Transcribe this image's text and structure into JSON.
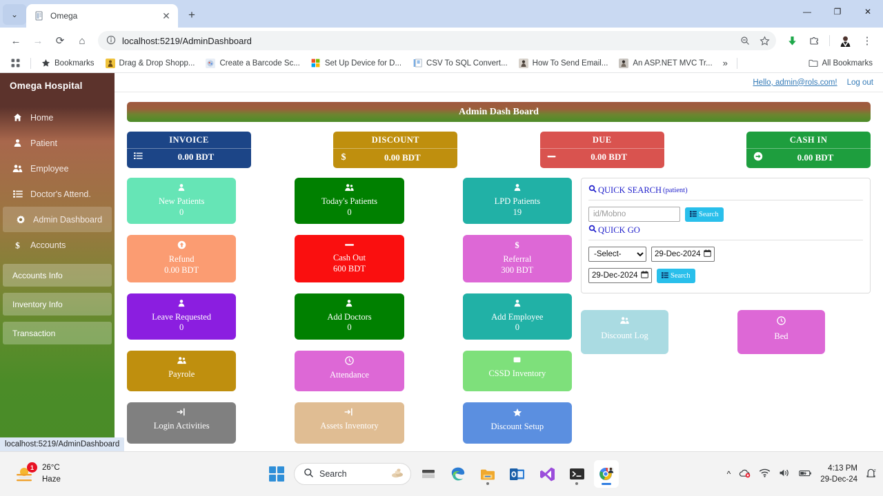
{
  "browser": {
    "tab": {
      "title": "Omega",
      "favicon": "document-icon",
      "close_label": "✕"
    },
    "newtab_label": "+",
    "tab_list_label": "⌄",
    "window_controls": {
      "minimize": "—",
      "restore": "❐",
      "close": "✕"
    },
    "nav": {
      "back": "←",
      "forward": "→",
      "reload": "⟳",
      "home": "⌂"
    },
    "omnibox": {
      "info_icon": "info-icon",
      "url": "localhost:5219/AdminDashboard",
      "zoom_icon": "zoom-out-icon",
      "bookmark_icon": "star-icon"
    },
    "toolbar_right": {
      "downloads": "download-icon",
      "extensions": "extensions-icon",
      "profile": "profile-avatar",
      "menu": "⋮"
    },
    "bookmarks": {
      "apps_icon": "apps-grid-icon",
      "items": [
        {
          "label": "Bookmarks",
          "icon": "star-icon"
        },
        {
          "label": "Drag & Drop Shopp...",
          "icon": "site-favicon"
        },
        {
          "label": "Create a Barcode Sc...",
          "icon": "site-favicon"
        },
        {
          "label": "Set Up Device for D...",
          "icon": "microsoft-icon"
        },
        {
          "label": "CSV To SQL Convert...",
          "icon": "site-favicon"
        },
        {
          "label": "How To Send Email...",
          "icon": "site-favicon"
        },
        {
          "label": "An ASP.NET MVC Tr...",
          "icon": "site-favicon"
        }
      ],
      "overflow": "»",
      "all_bookmarks": "All Bookmarks"
    },
    "status_bubble": "localhost:5219/AdminDashboard"
  },
  "sidebar": {
    "brand": "Omega Hospital",
    "items": [
      {
        "label": "Home",
        "icon": "home-icon"
      },
      {
        "label": "Patient",
        "icon": "user-icon"
      },
      {
        "label": "Employee",
        "icon": "users-icon"
      },
      {
        "label": "Doctor's Attend.",
        "icon": "list-icon"
      },
      {
        "label": "Admin Dashboard",
        "icon": "gear-icon",
        "active": true
      },
      {
        "label": "Accounts",
        "icon": "dollar-icon"
      }
    ],
    "groups": [
      {
        "label": "Accounts Info"
      },
      {
        "label": "Inventory Info"
      },
      {
        "label": "Transaction"
      }
    ]
  },
  "userbar": {
    "hello": "Hello, admin@rols.com!",
    "logout": "Log out"
  },
  "page": {
    "banner_title": "Admin Dash Board",
    "stats": [
      {
        "title": "INVOICE",
        "value": "0.00 BDT",
        "icon": "list-icon",
        "color": "#1c4587"
      },
      {
        "title": "DISCOUNT",
        "value": "0.00 BDT",
        "icon": "dollar-icon",
        "color": "#bf8f0e"
      },
      {
        "title": "DUE",
        "value": "0.00 BDT",
        "icon": "minus-icon",
        "color": "#d9534f"
      },
      {
        "title": "CASH IN",
        "value": "0.00 BDT",
        "icon": "arrow-right-circle-icon",
        "color": "#1e9e3e"
      }
    ],
    "tiles": [
      {
        "label": "New Patients",
        "value": "0",
        "icon": "user-icon",
        "color": "#66e5b6",
        "height": "tall"
      },
      {
        "label": "Today's Patients",
        "value": "0",
        "icon": "users-icon",
        "color": "#008000",
        "height": "tall"
      },
      {
        "label": "LPD Patients",
        "value": "19",
        "icon": "user-icon",
        "color": "#21b1a6",
        "height": "tall"
      },
      {
        "label": "Refund",
        "value": "0.00 BDT",
        "icon": "arrow-up-circle-icon",
        "color": "#fb9c72",
        "height": "tall"
      },
      {
        "label": "Cash Out",
        "value": "600 BDT",
        "icon": "minus-icon",
        "color": "#fa0f0f",
        "height": "tall"
      },
      {
        "label": "Referral",
        "value": "300 BDT",
        "icon": "dollar-icon",
        "color": "#dd68d6",
        "height": "tall"
      },
      {
        "label": "Leave Requested",
        "value": "0",
        "icon": "user-icon",
        "color": "#8b1ee0",
        "height": "tall"
      },
      {
        "label": "Add Doctors",
        "value": "0",
        "icon": "user-icon",
        "color": "#008000",
        "height": "tall"
      },
      {
        "label": "Add Employee",
        "value": "0",
        "icon": "user-icon",
        "color": "#21b1a6",
        "height": "tall"
      },
      {
        "label": "Payrole",
        "value": "",
        "icon": "users-icon",
        "color": "#bf8f0e",
        "height": "short"
      },
      {
        "label": "Attendance",
        "value": "",
        "icon": "clock-icon",
        "color": "#dd68d6",
        "height": "short"
      },
      {
        "label": "CSSD Inventory",
        "value": "",
        "icon": "square-icon",
        "color": "#7ee07b",
        "height": "short"
      },
      {
        "label": "Login Activities",
        "value": "",
        "icon": "login-icon",
        "color": "#808080",
        "height": "short"
      },
      {
        "label": "Assets Inventory",
        "value": "",
        "icon": "login-icon",
        "color": "#e0bd93",
        "height": "short"
      },
      {
        "label": "Discount Setup",
        "value": "",
        "icon": "star-icon",
        "color": "#5b8fe0",
        "height": "short"
      }
    ],
    "search_panel": {
      "quick_search_title": "QUICK SEARCH",
      "quick_search_sub": "(patient)",
      "quick_search_icon": "search-icon",
      "id_placeholder": "id/Mobno",
      "id_value": "",
      "search_button": "Search",
      "search_button_icon": "list-icon",
      "quick_go_title": "QUICK GO",
      "quick_go_icon": "search-icon",
      "select_value": "-Select-",
      "select_options": [
        "-Select-"
      ],
      "date_from": "29-Dec-2024",
      "date_to": "29-Dec-2024",
      "calendar_icon": "calendar-icon",
      "search_button2": "Search",
      "search_button2_icon": "list-icon"
    },
    "bottom_tiles": [
      {
        "label": "Discount Log",
        "icon": "users-icon",
        "color": "#aadbe2"
      },
      {
        "label": "Bed",
        "icon": "clock-icon",
        "color": "#dd68d6"
      }
    ]
  },
  "taskbar": {
    "weather": {
      "temp": "26°C",
      "condition": "Haze",
      "badge": "1",
      "icon": "haze-icon"
    },
    "start_label": "windows-start-icon",
    "search_placeholder": "Search",
    "search_icon": "search-icon",
    "pinned": [
      {
        "name": "file-explorer-icon"
      },
      {
        "name": "edge-icon"
      },
      {
        "name": "folder-icon"
      },
      {
        "name": "outlook-icon"
      },
      {
        "name": "visual-studio-icon"
      },
      {
        "name": "terminal-icon"
      },
      {
        "name": "chrome-icon"
      }
    ],
    "tray": {
      "chevron": "^",
      "onedrive": "cloud-icon",
      "wifi": "wifi-icon",
      "volume": "volume-icon",
      "battery": "battery-icon",
      "time": "4:13 PM",
      "date": "29-Dec-24",
      "notifications": "notification-icon"
    }
  }
}
